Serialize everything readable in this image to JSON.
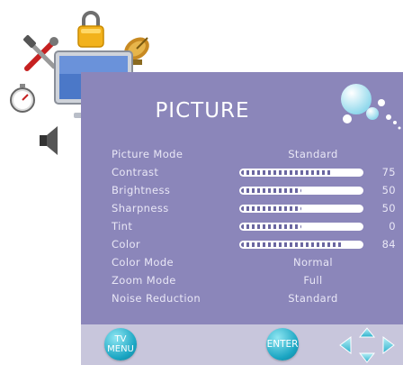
{
  "colors": {
    "panel_bg": "#8b86ba",
    "bottom_bar_bg": "#c8c6dc",
    "text": "#e9e7f6",
    "button_accent": "#1ba6c3"
  },
  "menu_icons": [
    "lock-icon",
    "tools-icon",
    "satellite-dish-icon",
    "tv-icon",
    "stopwatch-icon",
    "speaker-icon"
  ],
  "title": "PICTURE",
  "rows": [
    {
      "label": "Picture Mode",
      "value": "Standard"
    },
    {
      "label": "Contrast",
      "level": 75,
      "num": "75"
    },
    {
      "label": "Brightness",
      "level": 50,
      "num": "50"
    },
    {
      "label": "Sharpness",
      "level": 50,
      "num": "50"
    },
    {
      "label": "Tint",
      "level": 50,
      "num": "0"
    },
    {
      "label": "Color",
      "level": 84,
      "num": "84"
    },
    {
      "label": "Color Mode",
      "value": "Normal"
    },
    {
      "label": "Zoom Mode",
      "value": "Full"
    },
    {
      "label": "Noise Reduction",
      "value": "Standard"
    }
  ],
  "bottom": {
    "tv_line": "TV",
    "menu_line": "MENU",
    "enter_label": "ENTER"
  }
}
